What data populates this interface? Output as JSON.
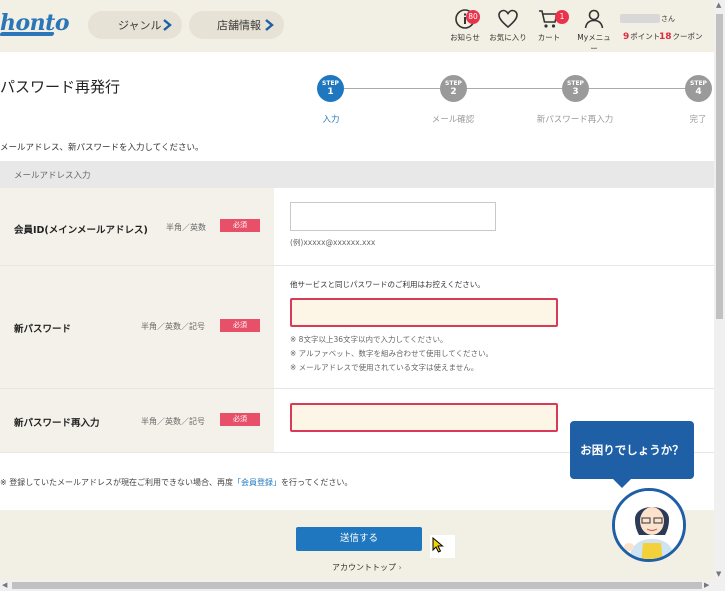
{
  "header": {
    "logo": "honto",
    "nav_genre": "ジャンル",
    "nav_store": "店舗情報",
    "notifications_label": "お知らせ",
    "notifications_count": "80",
    "favorites_label": "お気に入り",
    "cart_label": "カート",
    "cart_count": "1",
    "mymenu_label": "Myメニュー",
    "user_suffix": "さん",
    "points_value": "9",
    "points_label": "ポイント",
    "coupons_value": "18",
    "coupons_label": "クーポン"
  },
  "page": {
    "title": "パスワード再発行",
    "instruction": "メールアドレス、新パスワードを入力してください。",
    "section_label": "メールアドレス入力"
  },
  "steps": [
    {
      "step": "STEP",
      "num": "1",
      "label": "入力",
      "active": true
    },
    {
      "step": "STEP",
      "num": "2",
      "label": "メール確認",
      "active": false
    },
    {
      "step": "STEP",
      "num": "3",
      "label": "新パスワード再入力",
      "active": false
    },
    {
      "step": "STEP",
      "num": "4",
      "label": "完了",
      "active": false
    }
  ],
  "form": {
    "required_label": "必須",
    "member_id": {
      "label": "会員ID(メインメールアドレス)",
      "type": "半角／英数",
      "value": "",
      "example": "(例)xxxxx@xxxxxx.xxx"
    },
    "new_password": {
      "label": "新パスワード",
      "type": "半角／英数／記号",
      "value": "",
      "warning": "他サービスと同じパスワードのご利用はお控えください。",
      "notes": [
        "※ 8文字以上36文字以内で入力してください。",
        "※ アルファベット、数字を組み合わせて使用してください。",
        "※ メールアドレスで使用されている文字は使えません。"
      ]
    },
    "confirm_password": {
      "label": "新パスワード再入力",
      "type": "半角／英数／記号",
      "value": ""
    }
  },
  "footnote": {
    "before": "※ 登録していたメールアドレスが現在ご利用できない場合、再度",
    "link": "「会員登録」",
    "after": "を行ってください。"
  },
  "actions": {
    "submit": "送信する",
    "account_top": "アカウントトップ"
  },
  "help": {
    "bubble": "お困りでしょうか？"
  },
  "colors": {
    "brand": "#1f78bf",
    "required": "#e8506a",
    "error_border": "#d83a58",
    "badge": "#e8334a"
  }
}
